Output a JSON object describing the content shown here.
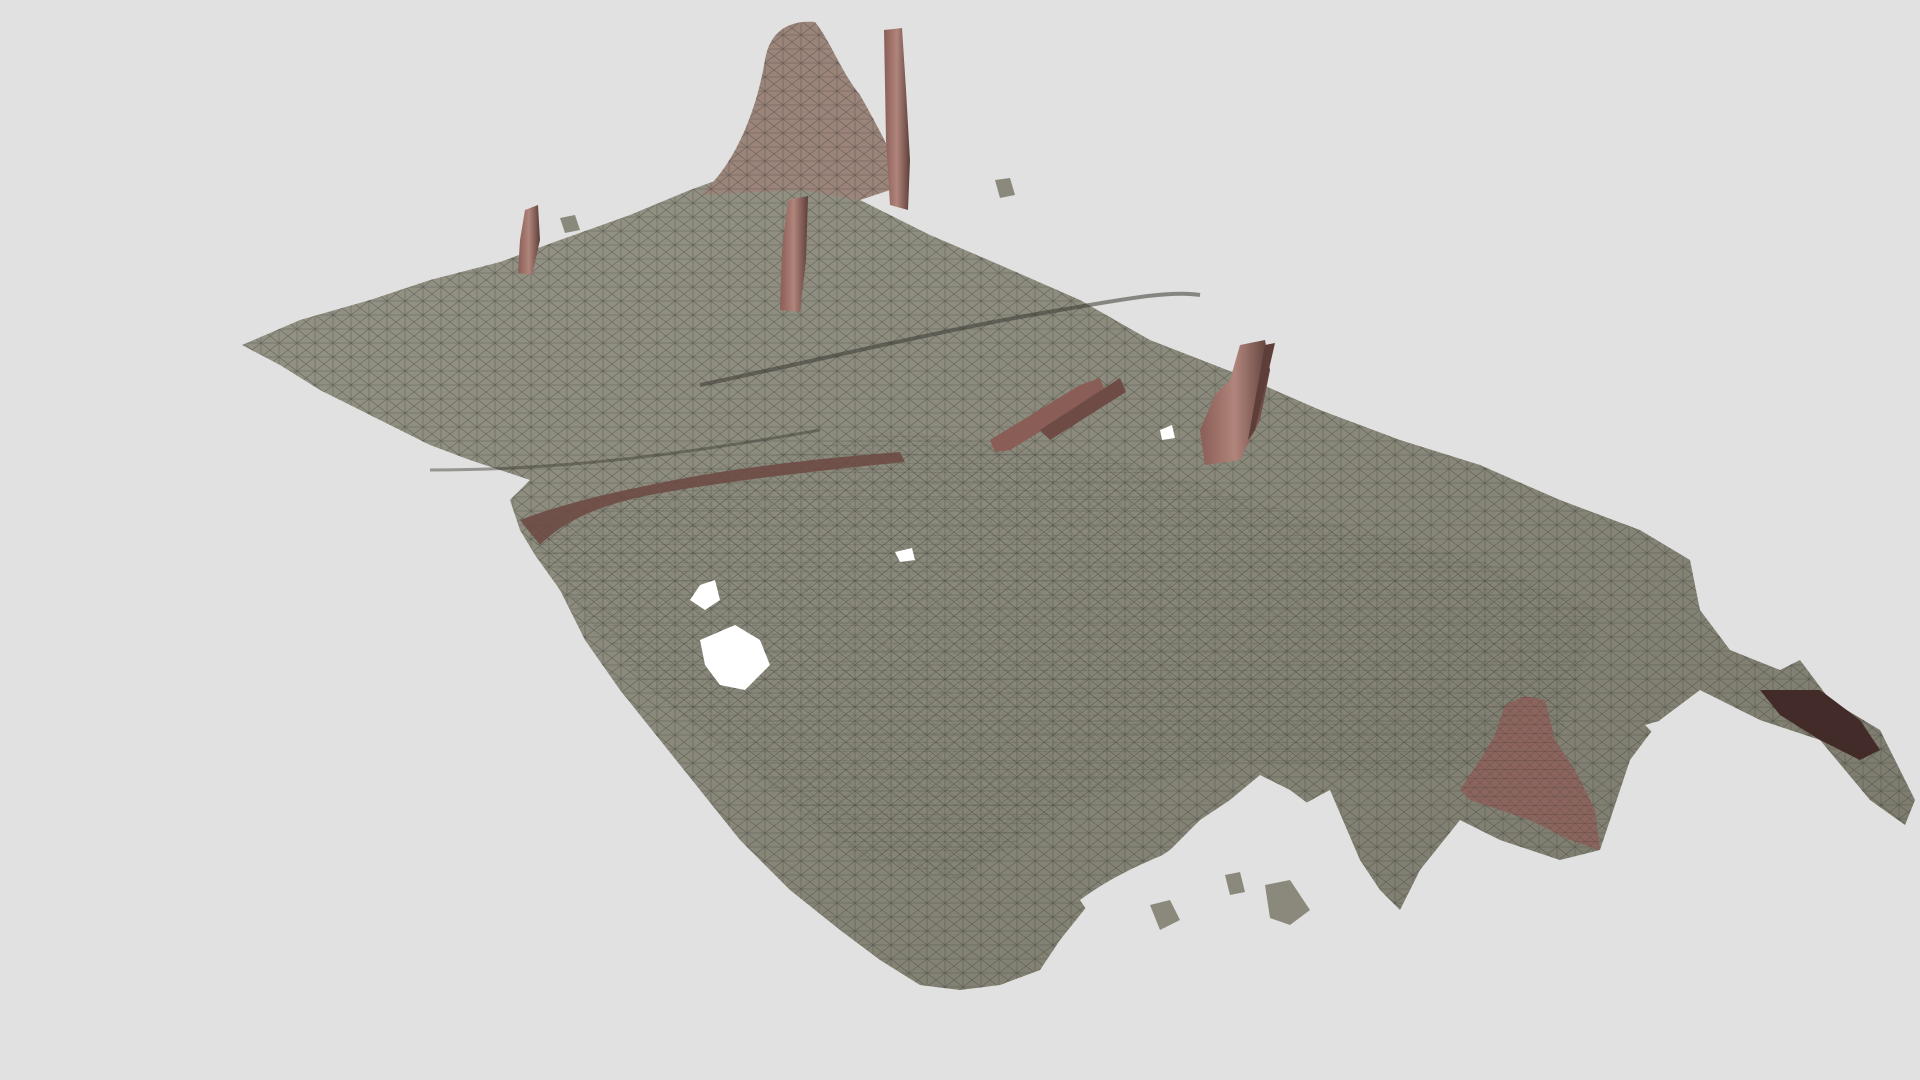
{
  "viewer": {
    "background_color": "#e1e1e1",
    "mesh_color": "#8f8f81",
    "mesh_shadow_color": "#6f6e61",
    "wire_color": "#2f2e28",
    "feature_color": "#6e4b45",
    "feature_dark_color": "#422b28",
    "hole_color": "#ffffff"
  }
}
